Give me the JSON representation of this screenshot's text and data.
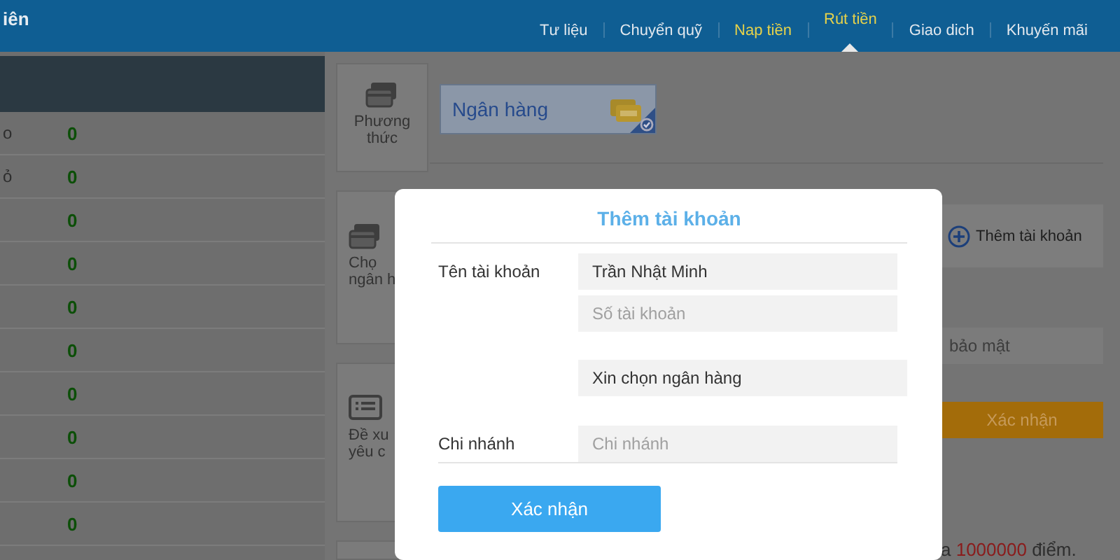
{
  "header": {
    "title": "iên",
    "nav": [
      {
        "label": "Tư liệu",
        "highlighted": false,
        "selected": false
      },
      {
        "label": "Chuyển quỹ",
        "highlighted": false,
        "selected": false
      },
      {
        "label": "Nap tiền",
        "highlighted": true,
        "selected": false
      },
      {
        "label": "Rút tiền",
        "highlighted": true,
        "selected": true
      },
      {
        "label": "Giao dich",
        "highlighted": false,
        "selected": false
      },
      {
        "label": "Khuyến mãi",
        "highlighted": false,
        "selected": false
      }
    ]
  },
  "sidebar": {
    "rows": [
      {
        "label": "o",
        "value": "0"
      },
      {
        "label": "ỏ",
        "value": "0"
      },
      {
        "value": "0"
      },
      {
        "value": "0"
      },
      {
        "value": "0"
      },
      {
        "value": "0"
      },
      {
        "value": "0"
      },
      {
        "value": "0"
      },
      {
        "value": "0"
      },
      {
        "value": "0"
      }
    ]
  },
  "steps": [
    {
      "label": "Phương thức",
      "kind": "full"
    },
    {
      "label": "Chọ ngân h",
      "kind": "partial"
    },
    {
      "label": "Đề xu yêu c",
      "kind": "partial"
    },
    {
      "kind": "empty"
    }
  ],
  "method": {
    "label": "Ngân hàng",
    "selected": true
  },
  "add_account_button": "Thêm tài khoản",
  "security_field": {
    "placeholder": "bảo mật"
  },
  "confirm_button": "Xác nhận",
  "note": [
    {
      "text": "a "
    },
    {
      "text": "1000000",
      "kind": "amount"
    },
    {
      "text": " điểm."
    }
  ],
  "modal": {
    "title": "Thêm tài khoản",
    "fields": [
      {
        "label": "Tên tài khoản",
        "value": "Trần Nhật Minh",
        "kind": "text"
      },
      {
        "placeholder": "Số tài khoản",
        "kind": "text"
      },
      {
        "value": "Xin chọn ngân hàng",
        "kind": "select"
      },
      {
        "label": "Chi nhánh",
        "placeholder": "Chi nhánh",
        "kind": "text"
      }
    ],
    "button": "Xác nhận"
  }
}
